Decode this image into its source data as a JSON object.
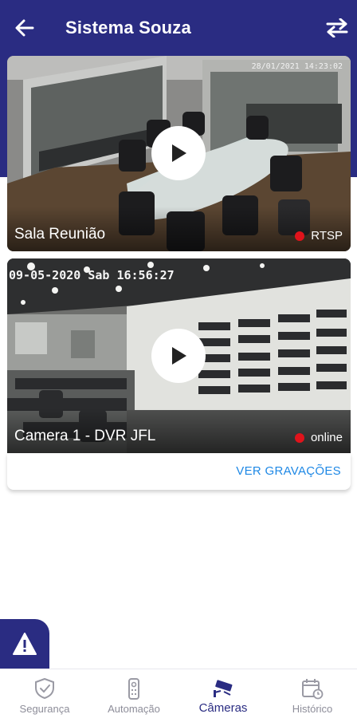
{
  "header": {
    "title": "Sistema Souza",
    "back_icon": "arrow-left-icon",
    "swap_icon": "swap-arrows-icon"
  },
  "cameras": [
    {
      "name": "Sala Reunião",
      "status": "RTSP",
      "timestamp": "28/01/2021 14:23:02"
    },
    {
      "name": "Camera 1 - DVR JFL",
      "status": "online",
      "timestamp": "09-05-2020 Sab 16:56:27"
    }
  ],
  "recordings_link": "VER GRAVAÇÕES",
  "bottom_nav": [
    {
      "label": "Segurança",
      "icon": "shield-check-icon"
    },
    {
      "label": "Automação",
      "icon": "remote-control-icon"
    },
    {
      "label": "Câmeras",
      "icon": "cctv-camera-icon",
      "active": true
    },
    {
      "label": "Histórico",
      "icon": "calendar-history-icon"
    }
  ],
  "colors": {
    "primary": "#2a2c82",
    "link": "#1e88e5",
    "status_dot": "#e0131b",
    "nav_inactive": "#8d8d99"
  }
}
